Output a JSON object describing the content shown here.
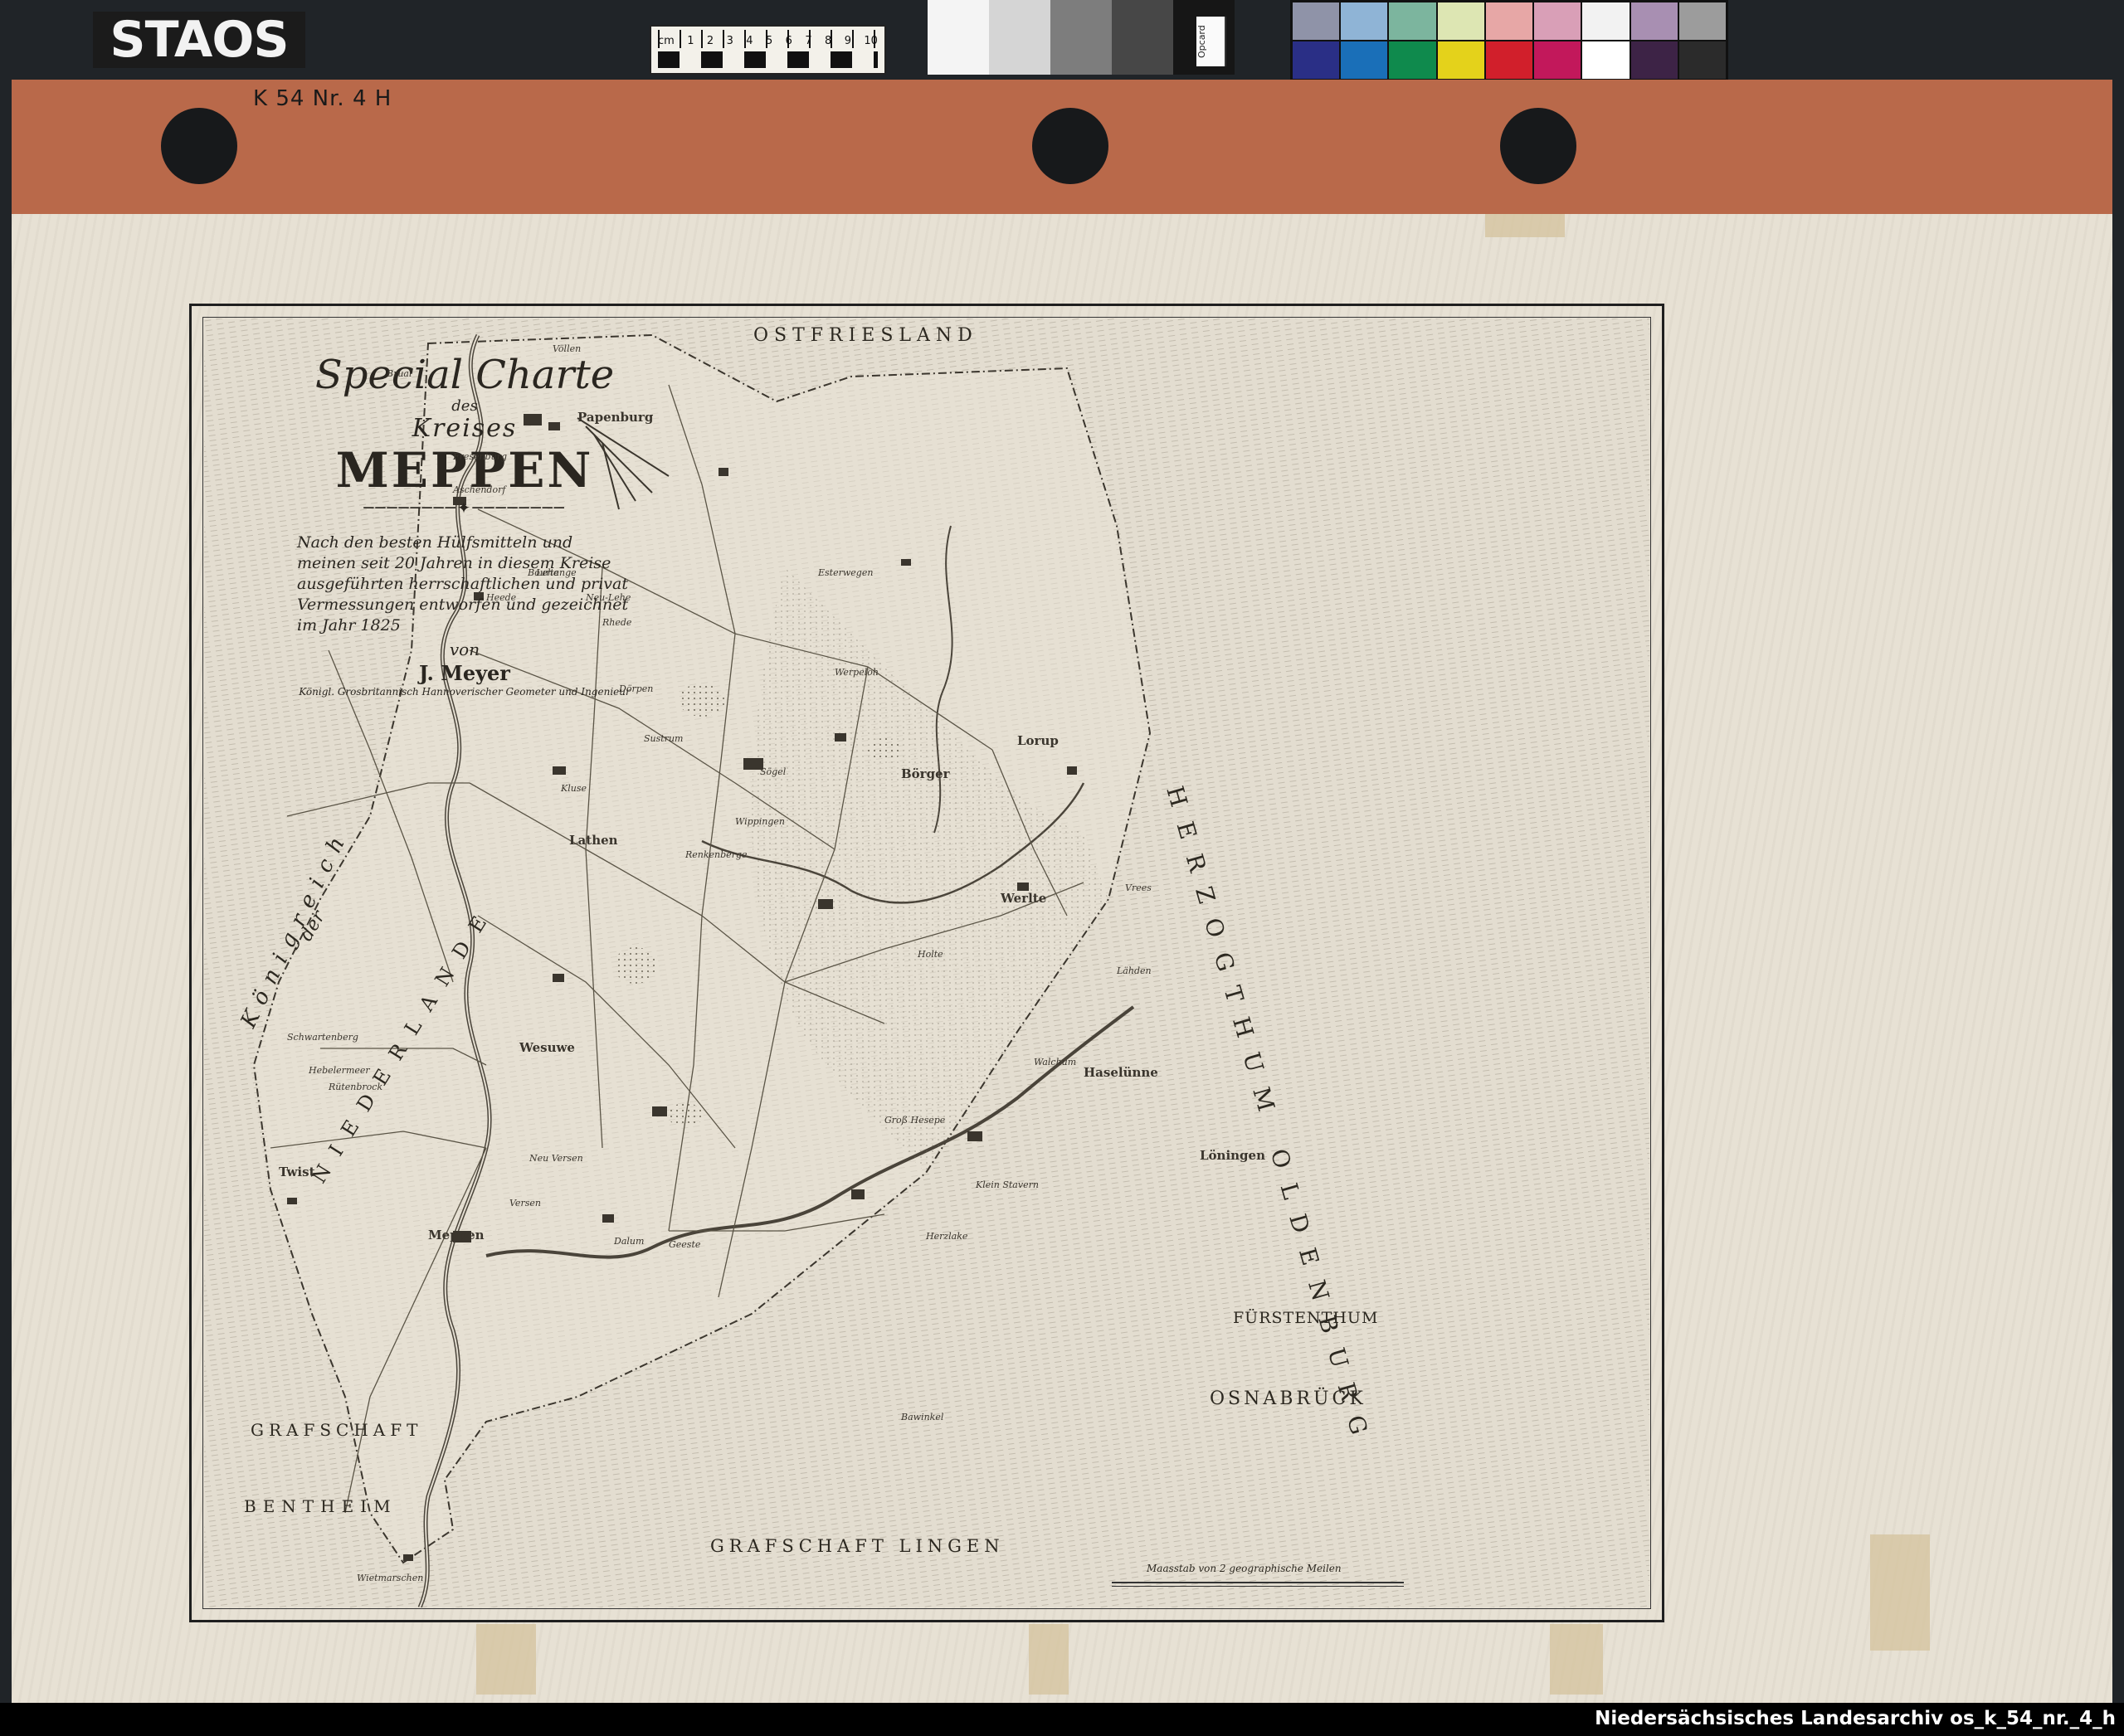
{
  "header": {
    "logo_text": "STAOS",
    "cm_scale": {
      "unit": "cm",
      "numbers": [
        "1",
        "2",
        "3",
        "4",
        "5",
        "6",
        "7",
        "8",
        "9",
        "10"
      ]
    },
    "gray_card_label": "Opcard",
    "archive_mark": "K 54  Nr. 4  H",
    "color_patches": [
      "#8f93a8",
      "#8fb4d6",
      "#7cb59e",
      "#dde6b3",
      "#e7a7a6",
      "#d99fb7",
      "#f2f2f2",
      "#a88fb2",
      "#9c9c9c",
      "#2a2f86",
      "#1a6fb8",
      "#0f8a4d",
      "#e4d21b",
      "#d11f2b",
      "#c2185b",
      "#ffffff",
      "#3d2346",
      "#2b2b2b"
    ],
    "gray_steps": [
      "#f4f4f4",
      "#d5d5d5",
      "#7d7d7d",
      "#474747",
      "#161616"
    ]
  },
  "map": {
    "title_special": "Special Charte",
    "title_des": "des",
    "title_kreises": "Kreises",
    "title_meppen": "MEPPEN",
    "description": "Nach den besten Hülfsmitteln und meinen seit 20 Jahren in diesem Kreise ausgeführten herrschaftlichen und privat Vermessungen entworfen und gezeichnet im Jahr 1825",
    "von": "von",
    "author": "J. Meyer",
    "author_role": "Königl. Grosbritannisch Hannoverischer Geometer und Ingenieur",
    "regions": {
      "ostfriesland": "OSTFRIESLAND",
      "oldenburg": "HERZOGTHUM OLDENBURG",
      "koenigreich": "Königreich",
      "der": "der",
      "niederlande": "NIEDERLANDE",
      "fuerstenthum": "FÜRSTENTHUM",
      "osnabrueck": "OSNABRÜCK",
      "grafschaft_bentheim_1": "GRAFSCHAFT",
      "grafschaft_bentheim_2": "BENTHEIM",
      "grafschaft_lingen": "GRAFSCHAFT LINGEN"
    },
    "places": [
      "Völlen",
      "Papenburg",
      "Börger",
      "Lorup",
      "Sögel",
      "Werlte",
      "Haselünne",
      "Meppen",
      "Herzlake",
      "Lathen",
      "Twist",
      "Wesuwe",
      "Fresenburg",
      "Aschendorf",
      "Lehe",
      "Heede",
      "Dörpen",
      "Rhede",
      "Brual",
      "Esterwegen",
      "Löningen",
      "Vrees",
      "Lähden",
      "Rütenbrock",
      "Neu-Lehe",
      "Kluse",
      "Werpeloh",
      "Wippingen",
      "Renkenberge",
      "Sustrum",
      "Bourtange",
      "Hebelermeer",
      "Schwartenberg",
      "Wietmarschen",
      "Versen",
      "Dalum",
      "Geeste",
      "Bawinkel",
      "Groß Hesepe",
      "Klein Stavern",
      "Neu Versen",
      "Walchum",
      "Holte"
    ],
    "scale_caption": "Maasstab von 2 geographische Meilen"
  },
  "footer": {
    "text": "Niedersächsisches Landesarchiv os_k_54_nr._4_h"
  }
}
